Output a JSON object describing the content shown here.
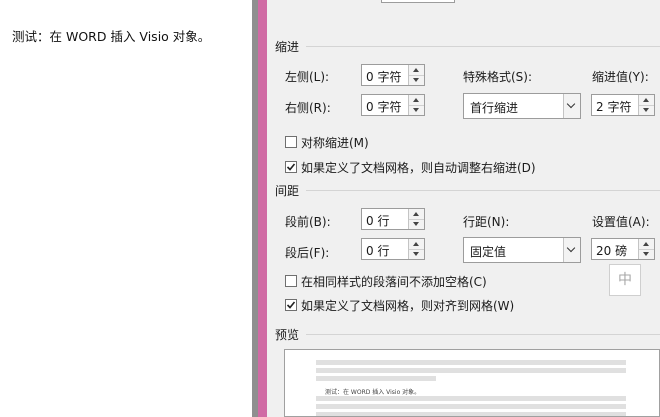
{
  "document": {
    "text": "测试：在 WORD 插入 Visio 对象。"
  },
  "dialog": {
    "indent": {
      "title": "缩进",
      "left_label": "左侧(L):",
      "left_value": "0 字符",
      "right_label": "右侧(R):",
      "right_value": "0 字符",
      "special_label": "特殊格式(S):",
      "special_value": "首行缩进",
      "amount_label": "缩进值(Y):",
      "amount_value": "2 字符",
      "mirror_label": "对称缩进(M)",
      "mirror_checked": false,
      "auto_adjust_label": "如果定义了文档网格，则自动调整右缩进(D)",
      "auto_adjust_checked": true
    },
    "spacing": {
      "title": "间距",
      "before_label": "段前(B):",
      "before_value": "0 行",
      "after_label": "段后(F):",
      "after_value": "0 行",
      "line_label": "行距(N):",
      "line_value": "固定值",
      "at_label": "设置值(A):",
      "at_value": "20 磅",
      "no_space_label": "在相同样式的段落间不添加空格(C)",
      "no_space_checked": false,
      "snap_grid_label": "如果定义了文档网格，则对齐到网格(W)",
      "snap_grid_checked": true
    },
    "preview": {
      "title": "预览",
      "sample_text": "测试：在 WORD 插入 Visio 对象。"
    }
  },
  "ime_indicator": {
    "label": "中"
  },
  "colors": {
    "accent_frame": "#d06ba4",
    "dialog_bg": "#f0f0f0"
  }
}
